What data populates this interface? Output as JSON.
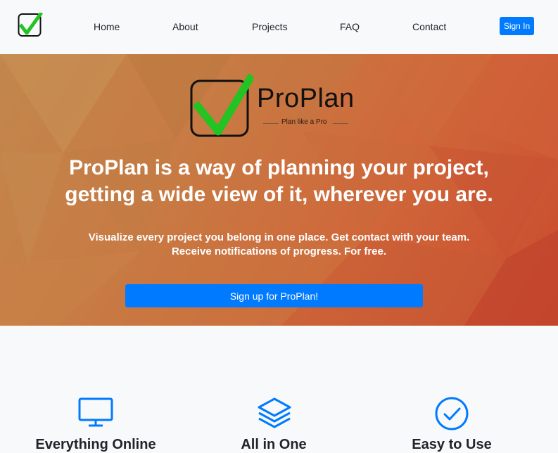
{
  "nav": {
    "logo_icon": "checkmark-logo-icon",
    "links": [
      "Home",
      "About",
      "Projects",
      "FAQ",
      "Contact"
    ],
    "signin_label": "Sign In"
  },
  "hero": {
    "brand_name": "ProPlan",
    "brand_tagline": "Plan like a Pro",
    "headline_line1": "ProPlan is a way of planning your project,",
    "headline_line2": "getting a wide view of it, wherever you are.",
    "sub_line1": "Visualize every project you belong in one place. Get contact with your team.",
    "sub_line2": "Receive notifications of progress. For free.",
    "cta_label": "Sign up for ProPlan!"
  },
  "features": [
    {
      "icon": "monitor-icon",
      "title": "Everything Online"
    },
    {
      "icon": "layers-icon",
      "title": "All in One"
    },
    {
      "icon": "check-circle-icon",
      "title": "Easy to Use"
    }
  ],
  "colors": {
    "accent": "#007bff",
    "check_green": "#22c322",
    "hero_start": "#c2874d",
    "hero_end": "#c94b2e"
  }
}
